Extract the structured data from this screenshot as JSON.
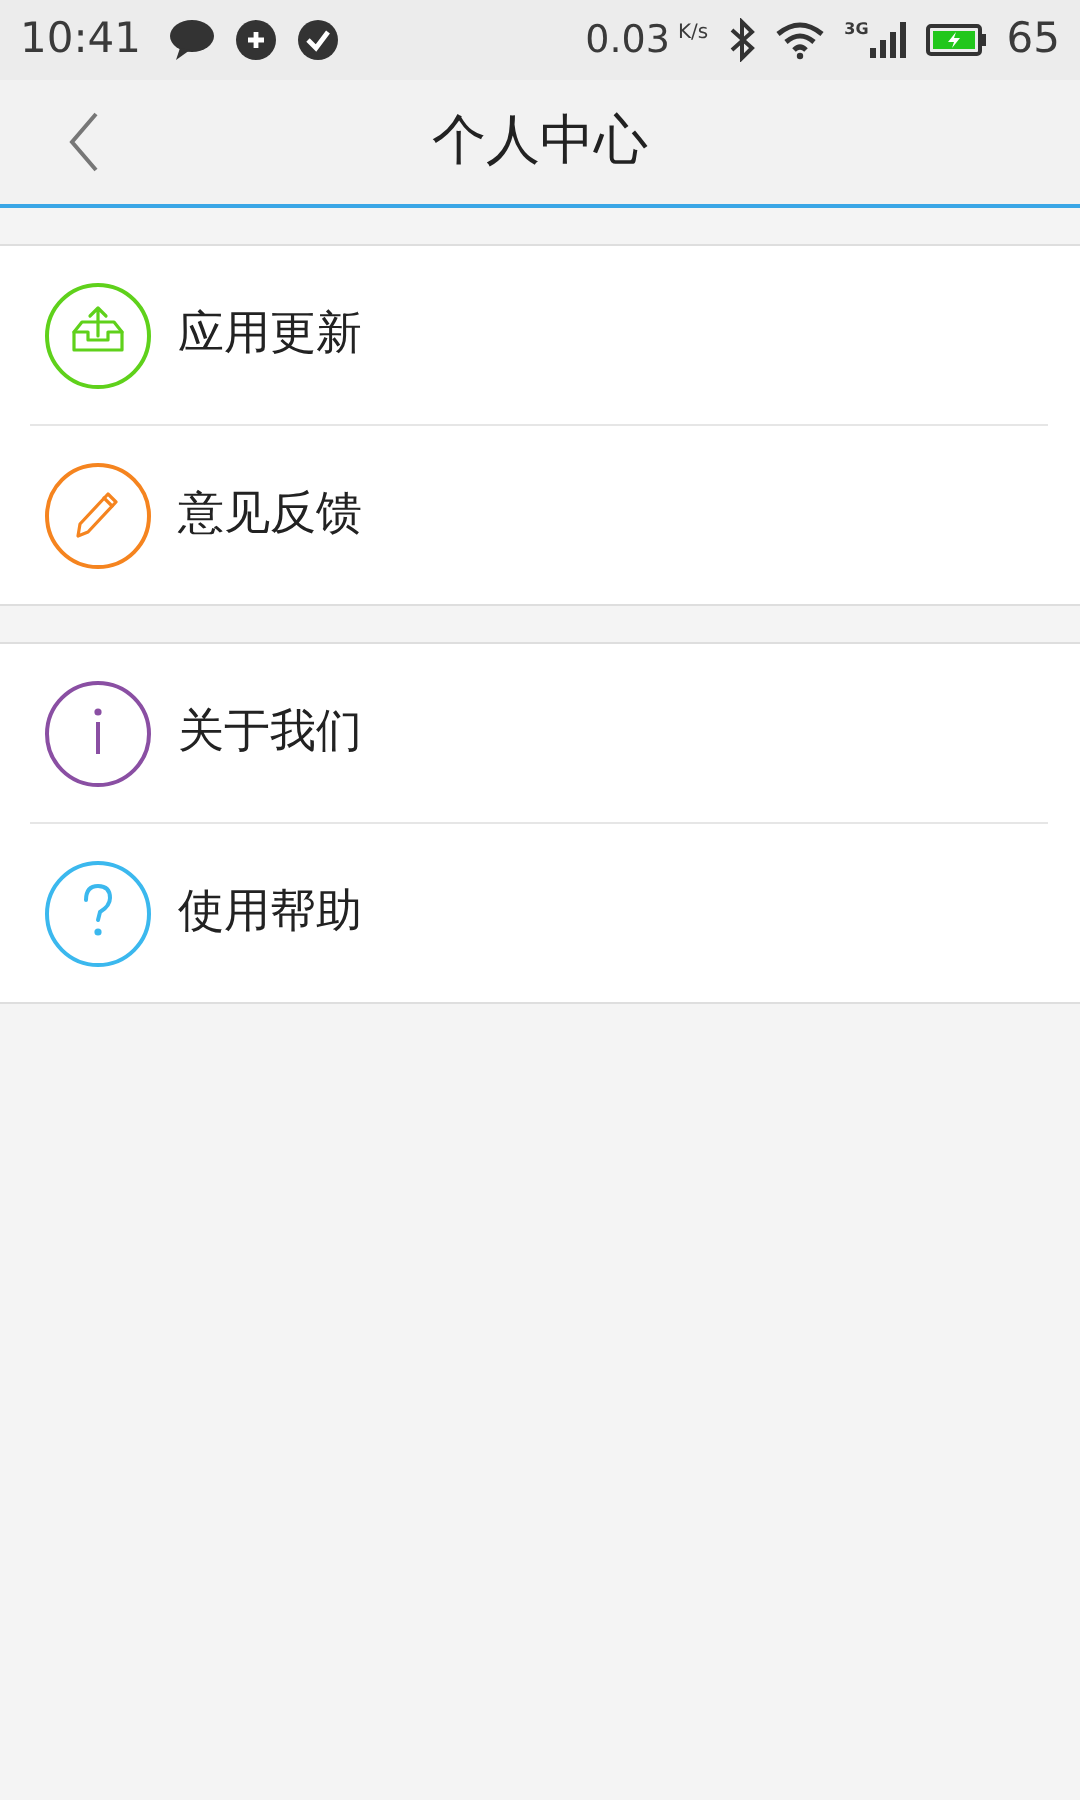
{
  "status_bar": {
    "time": "10:41",
    "speed": "0.03",
    "speed_unit": "K/s",
    "network": "3G",
    "battery": "65"
  },
  "header": {
    "title": "个人中心"
  },
  "groups": [
    {
      "items": [
        {
          "label": "应用更新",
          "kind": "update",
          "color": "#5fd11b"
        },
        {
          "label": "意见反馈",
          "kind": "feedback",
          "color": "#f5841f"
        }
      ]
    },
    {
      "items": [
        {
          "label": "关于我们",
          "kind": "about",
          "color": "#8a4fa3"
        },
        {
          "label": "使用帮助",
          "kind": "help",
          "color": "#3bb8ee"
        }
      ]
    }
  ]
}
